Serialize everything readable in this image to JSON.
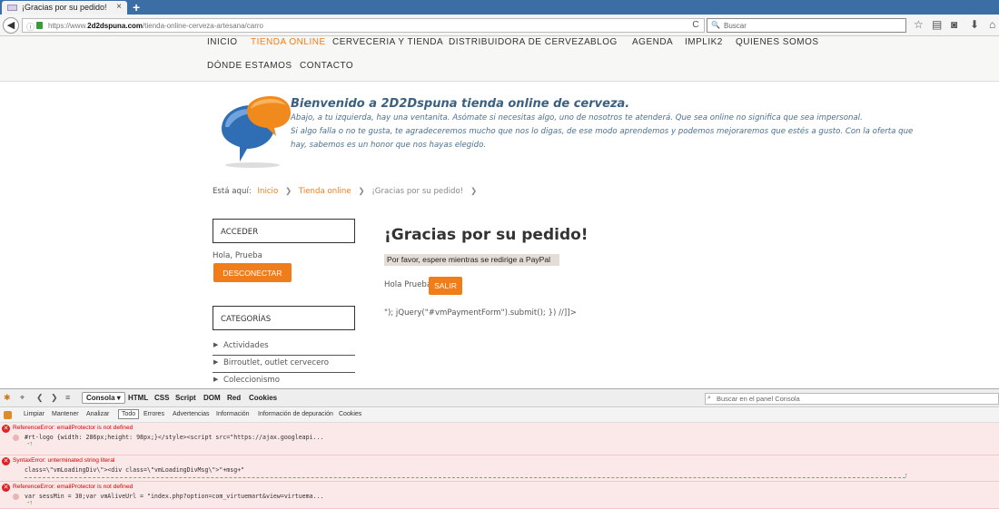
{
  "browser": {
    "tab_title": "¡Gracias por su pedido!",
    "tab_close": "×",
    "new_tab": "+",
    "back": "◀",
    "info": "ⓘ",
    "url_prefix": "https://www.",
    "url_domain": "2d2dspuna.com",
    "url_path": "/tienda-online-cerveza-artesana/carro",
    "reload": "C",
    "search_placeholder": "Buscar",
    "search_icon": "🔍",
    "icons": [
      "☆",
      "▤",
      "◙",
      "⬇",
      "⌂"
    ]
  },
  "menu": {
    "items": [
      "INICIO",
      "TIENDA ONLINE",
      "CERVECERIA Y TIENDA",
      "DISTRIBUIDORA DE CERVEZA",
      "BLOG",
      "AGENDA",
      "IMPLIK2",
      "QUIENES SOMOS"
    ],
    "items_row2": [
      "DÓNDE ESTAMOS",
      "CONTACTO"
    ],
    "active_color": "#f07d1a"
  },
  "welcome": {
    "title": "Bienvenido a 2D2Dspuna tienda online de cerveza.",
    "lines": [
      "Abajo, a tu izquierda, hay una ventanita. Asómate si necesitas algo, uno de nosotros te atenderá. Que sea online no significa que sea impersonal.",
      "Si algo falla o no te gusta, te agradeceremos mucho que nos lo digas, de ese modo aprendemos y podemos mejoraremos que estés a gusto. Con la oferta que",
      "hay, sabemos es un honor que nos hayas elegido."
    ]
  },
  "breadcrumb": {
    "prefix": "Está aquí:",
    "items": [
      "Inicio",
      "Tienda online",
      "¡Gracias por su pedido!"
    ],
    "sep": "❯"
  },
  "sidebar": {
    "acceder": "ACCEDER",
    "hola": "Hola, Prueba",
    "logout": "DESCONECTAR",
    "categorias": "CATEGORÍAS",
    "categories": [
      "Actividades",
      "Birroutlet, outlet cervecero",
      "Coleccionismo"
    ],
    "arrow": "▶"
  },
  "main": {
    "title": "¡Gracias por su pedido!",
    "wait": "Por favor, espere mientras se redirige a PayPal",
    "hola": "Hola Prueba",
    "salir": "SALIR",
    "js_leak": "\"); jQuery(\"#vmPaymentForm\").submit(); }) //]]>"
  },
  "devtools": {
    "tabs": [
      "Consola ▾",
      "HTML",
      "CSS",
      "Script",
      "DOM",
      "Red",
      "Cookies"
    ],
    "search_placeholder": "Buscar en el panel Consola",
    "filters": [
      "Limpiar",
      "Mantener",
      "Analizar",
      "Todo",
      "Errores",
      "Advertencias",
      "Información",
      "Información de depuración",
      "Cookies"
    ],
    "errors": [
      {
        "msg": "ReferenceError: emailProtector is not defined",
        "code": "#rt-logo {width: 286px;height: 98px;}</style><script src=\"https://ajax.googleapi..."
      },
      {
        "msg": "SyntaxError: unterminated string literal",
        "code": "class=\\\"vmLoadingDiv\\\"><div class=\\\"vmLoadingDivMsg\\\">\"+msg+\""
      },
      {
        "msg": "ReferenceError: emailProtector is not defined",
        "code": "var sessMin = 30;var vmAliveUrl = \"index.php?option=com_virtuemart&view=virtuema..."
      }
    ]
  }
}
